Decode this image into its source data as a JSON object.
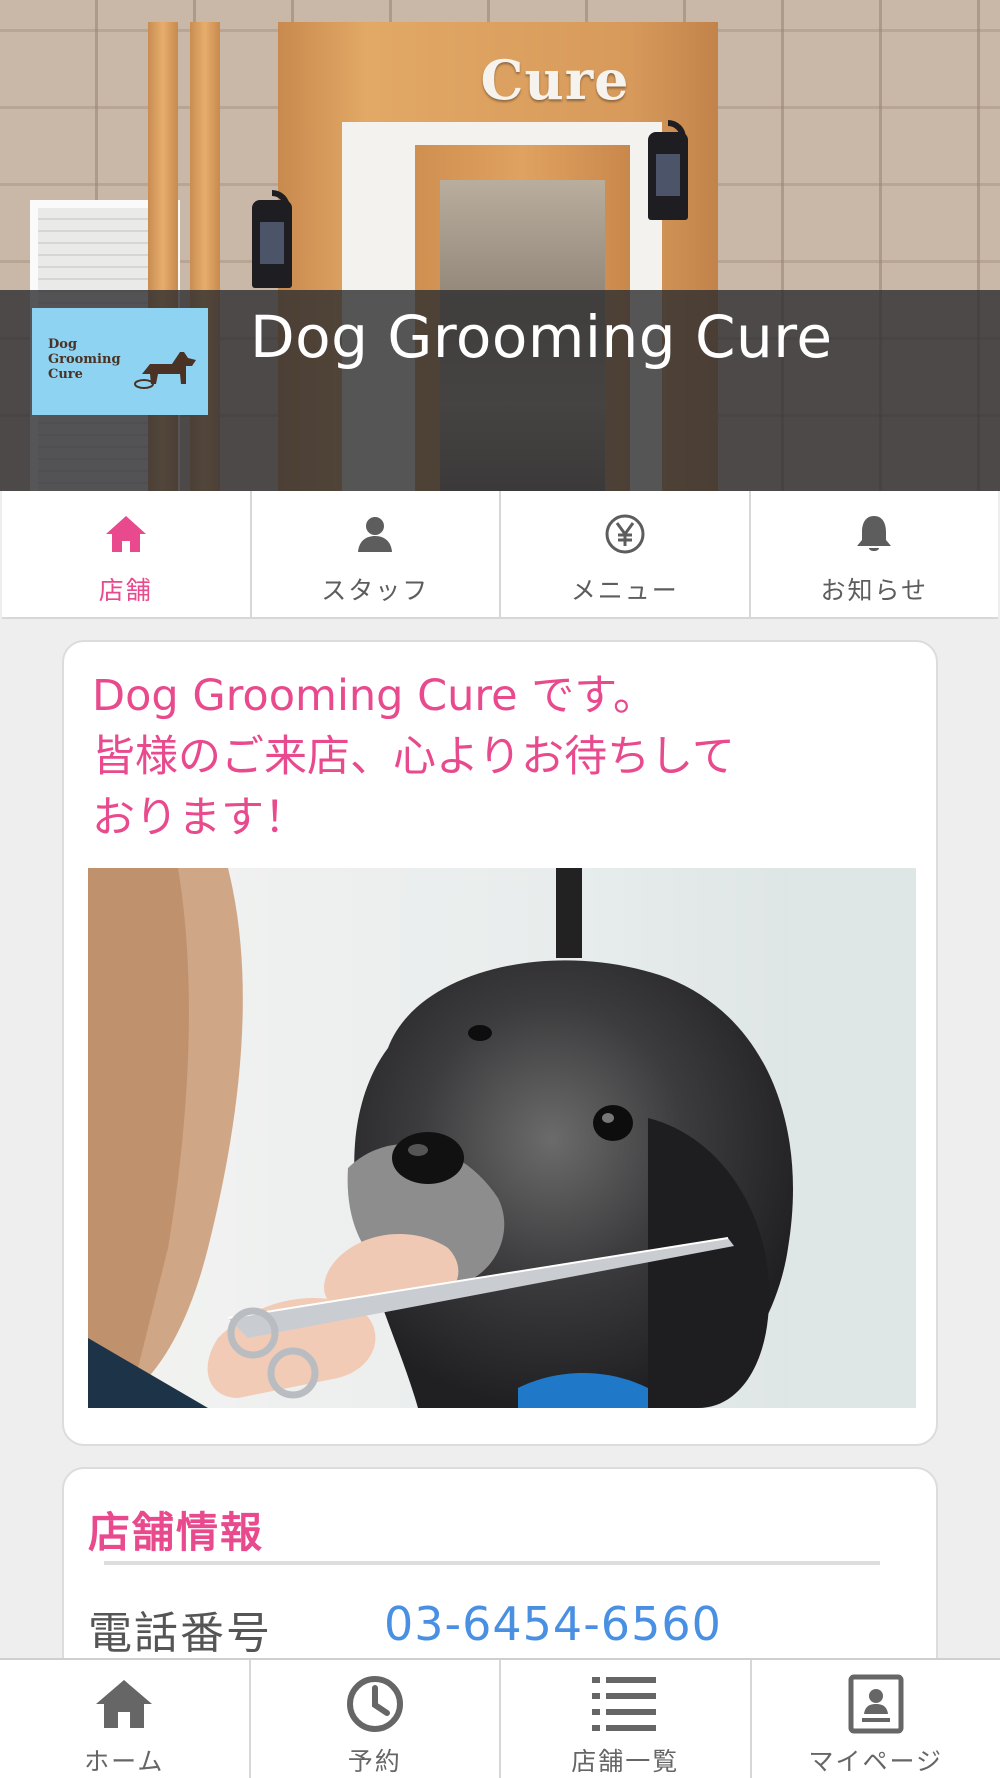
{
  "header": {
    "title": "Dog Grooming Cure",
    "sign_text": "Cure",
    "logo_lines": [
      "Dog",
      "Grooming",
      "Cure"
    ]
  },
  "tabs": [
    {
      "label": "店舗",
      "icon": "home-icon",
      "active": true
    },
    {
      "label": "スタッフ",
      "icon": "person-icon",
      "active": false
    },
    {
      "label": "メニュー",
      "icon": "yen-icon",
      "active": false
    },
    {
      "label": "お知らせ",
      "icon": "bell-icon",
      "active": false
    }
  ],
  "main": {
    "headline_lines": [
      "Dog Grooming Cure です。",
      "皆様のご来店、心よりお待ちして",
      "おります！"
    ]
  },
  "store_info": {
    "title": "店舗情報",
    "phone_label": "電話番号",
    "phone_value": "03-6454-6560"
  },
  "bottom_nav": [
    {
      "label": "ホーム",
      "icon": "home-icon"
    },
    {
      "label": "予約",
      "icon": "clock-icon"
    },
    {
      "label": "店舗一覧",
      "icon": "list-icon"
    },
    {
      "label": "マイページ",
      "icon": "profile-card-icon"
    }
  ],
  "colors": {
    "accent_pink": "#e84a8d",
    "link_blue": "#4a90e2",
    "tab_gray": "#5d5d5d"
  }
}
